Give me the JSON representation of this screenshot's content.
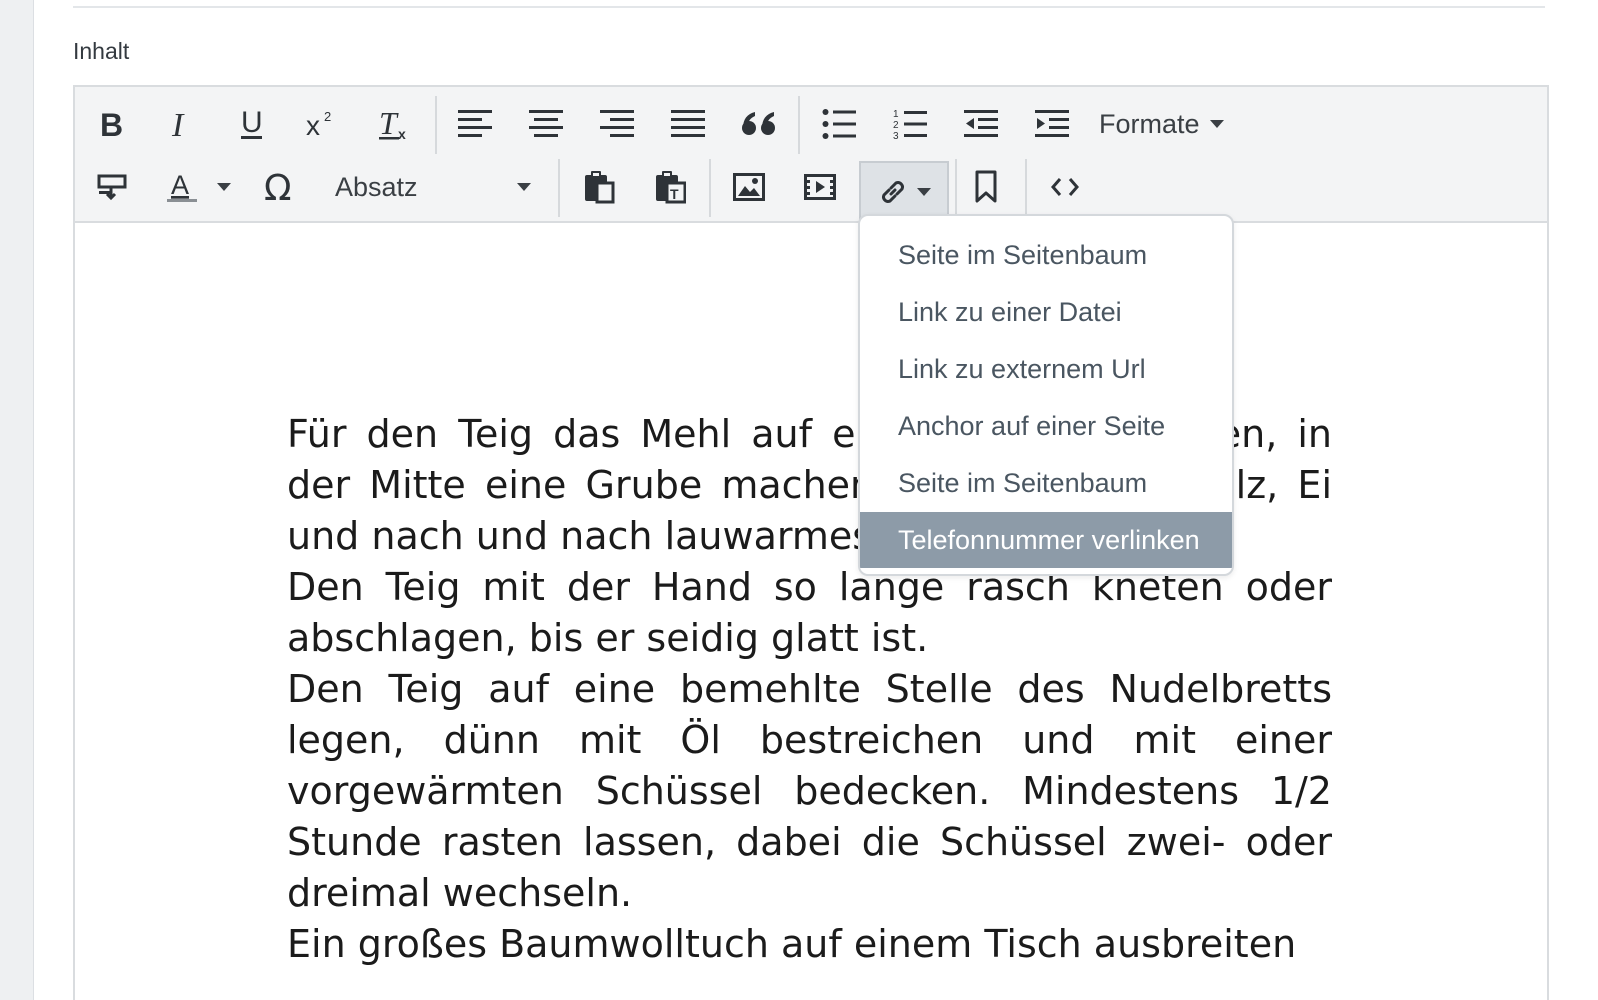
{
  "field": {
    "label": "Inhalt"
  },
  "toolbar": {
    "formats_label": "Formate",
    "block_format_label": "Absatz",
    "icons": [
      "bold-icon",
      "italic-icon",
      "underline-icon",
      "superscript-icon",
      "clear-formatting-icon",
      "align-left-icon",
      "align-center-icon",
      "align-right-icon",
      "align-justify-icon",
      "blockquote-icon",
      "bullet-list-icon",
      "numbered-list-icon",
      "outdent-icon",
      "indent-icon",
      "insert-template-icon",
      "text-color-icon",
      "special-character-icon",
      "paste-icon",
      "paste-as-text-icon",
      "image-icon",
      "video-icon",
      "link-icon",
      "bookmark-icon",
      "source-code-icon"
    ]
  },
  "link_menu": {
    "items": [
      {
        "label": "Seite im Seitenbaum"
      },
      {
        "label": "Link zu einer Datei"
      },
      {
        "label": "Link zu externem Url"
      },
      {
        "label": "Anchor auf einer Seite"
      },
      {
        "label": "Seite im Seitenbaum"
      },
      {
        "label": "Telefonnummer verlinken",
        "selected": true
      }
    ]
  },
  "content": {
    "paragraphs": [
      "Für den Teig das Mehl auf ein Nudelbrett häufen, in der Mitte eine Grube machen, mit Öl, Essig, Salz, Ei und nach und nach lauwarmes Wasser einrühren.",
      "Den Teig mit der Hand so lange rasch kneten oder abschlagen, bis er seidig glatt ist.",
      "Den Teig auf eine bemehlte Stelle des Nudelbretts legen, dünn mit Öl bestreichen und mit einer vorgewärmten Schüssel bedecken. Mindestens 1/2 Stunde rasten lassen, dabei die Schüssel zwei- oder dreimal wechseln.",
      "Ein großes Baumwolltuch auf einem Tisch ausbreiten"
    ]
  },
  "colors": {
    "menu_selected_bg": "#8d9ba8",
    "toolbar_bg": "#f3f4f5",
    "border": "#d9dcdf"
  }
}
